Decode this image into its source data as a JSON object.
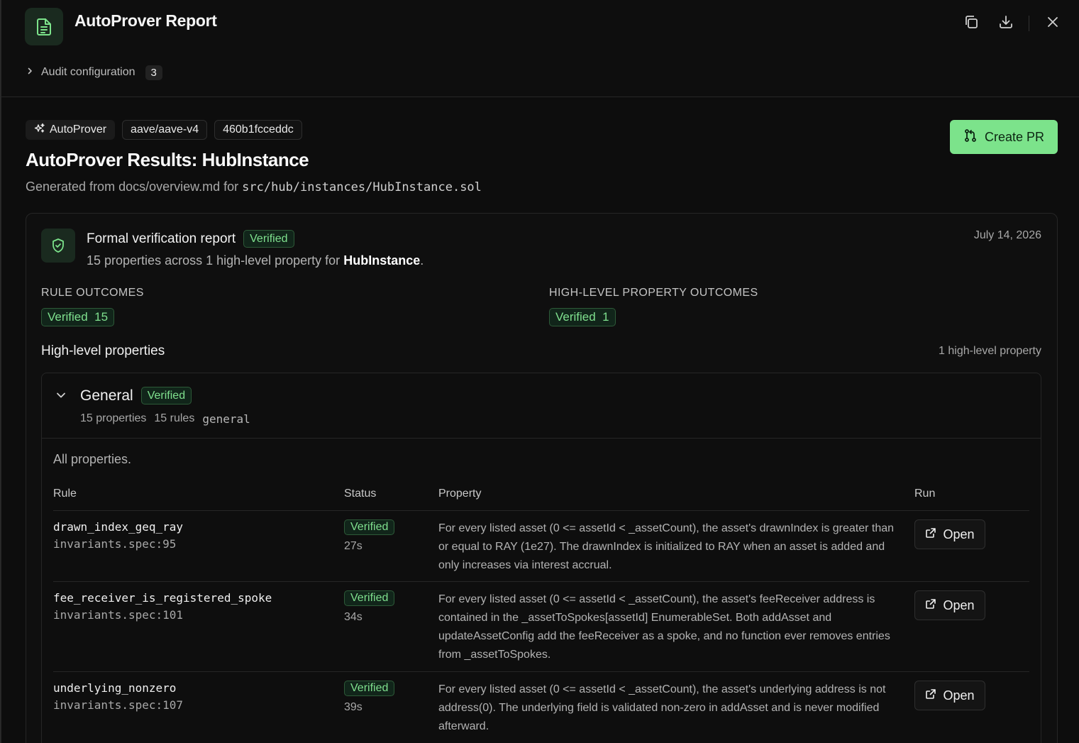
{
  "header": {
    "title": "AutoProver Report",
    "audit_label": "Audit configuration",
    "audit_count": "3",
    "icons": [
      "document-icon",
      "copy-icon",
      "download-icon",
      "close-icon"
    ]
  },
  "chips": [
    "AutoProver",
    "aave/aave-v4",
    "460b1fcceddc"
  ],
  "create_pr": "Create PR",
  "results_title": "AutoProver Results: HubInstance",
  "generated": {
    "prefix": "Generated from docs/overview.md for",
    "path": "src/hub/instances/HubInstance.sol"
  },
  "report": {
    "title": "Formal verification report",
    "status": "Verified",
    "subtitle_prefix": "15 properties across 1 high-level property for",
    "subject": "HubInstance",
    "subtitle_suffix": ".",
    "date": "July 14, 2026",
    "rule_outcomes_label": "RULE OUTCOMES",
    "rule_outcomes_badge": "Verified  15",
    "hlp_outcomes_label": "HIGH-LEVEL PROPERTY OUTCOMES",
    "hlp_outcomes_badge": "Verified  1",
    "hlp_title": "High-level properties",
    "hlp_count": "1 high-level property"
  },
  "group": {
    "title": "General",
    "status": "Verified",
    "properties": "15 properties",
    "rules": "15 rules",
    "tag": "general",
    "description": "All properties."
  },
  "table": {
    "headers": {
      "rule": "Rule",
      "status": "Status",
      "property": "Property",
      "run": "Run"
    },
    "rows": [
      {
        "rule": "drawn_index_geq_ray",
        "source": "invariants.spec:95",
        "status": "Verified",
        "time": "27s",
        "property": "For every listed asset (0 <= assetId < _assetCount), the asset's drawnIndex is greater than or equal to RAY (1e27). The drawnIndex is initialized to RAY when an asset is added and only increases via interest accrual.",
        "run": "Open"
      },
      {
        "rule": "fee_receiver_is_registered_spoke",
        "source": "invariants.spec:101",
        "status": "Verified",
        "time": "34s",
        "property": "For every listed asset (0 <= assetId < _assetCount), the asset's feeReceiver address is contained in the _assetToSpokes[assetId] EnumerableSet. Both addAsset and updateAssetConfig add the feeReceiver as a spoke, and no function ever removes entries from _assetToSpokes.",
        "run": "Open"
      },
      {
        "rule": "underlying_nonzero",
        "source": "invariants.spec:107",
        "status": "Verified",
        "time": "39s",
        "property": "For every listed asset (0 <= assetId < _assetCount), the asset's underlying address is not address(0). The underlying field is validated non-zero in addAsset and is never modified afterward.",
        "run": "Open"
      }
    ]
  },
  "colors": {
    "accent": "#7ce38b",
    "verified_text": "#7fe08e",
    "verified_bg": "#11251a",
    "background": "#0d0d0d"
  }
}
